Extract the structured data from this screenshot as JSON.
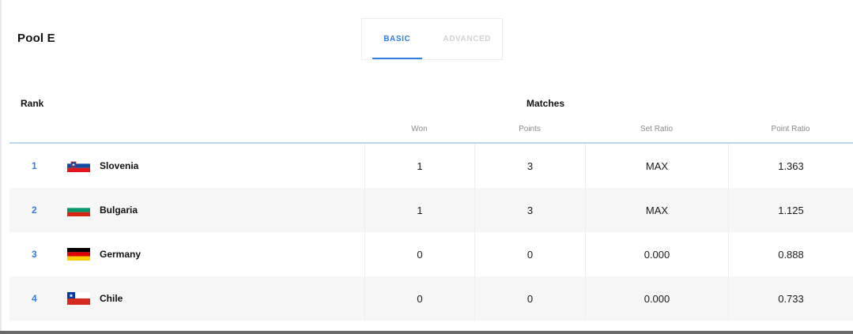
{
  "pool": {
    "title": "Pool E"
  },
  "tabs": [
    {
      "label": "BASIC",
      "active": true
    },
    {
      "label": "ADVANCED",
      "active": false
    }
  ],
  "headers": {
    "rank": "Rank",
    "matches": "Matches",
    "won": "Won",
    "points": "Points",
    "set_ratio": "Set Ratio",
    "point_ratio": "Point Ratio"
  },
  "colors": {
    "accent": "#2f7ee0",
    "inactive_tab": "#cfd3d8",
    "row_alt": "#f6f6f6",
    "header_rule": "#b9d4f3"
  },
  "rows": [
    {
      "rank": "1",
      "team": "Slovenia",
      "flag": "slovenia-flag-icon",
      "won": "1",
      "points": "3",
      "set_ratio": "MAX",
      "point_ratio": "1.363"
    },
    {
      "rank": "2",
      "team": "Bulgaria",
      "flag": "bulgaria-flag-icon",
      "won": "1",
      "points": "3",
      "set_ratio": "MAX",
      "point_ratio": "1.125"
    },
    {
      "rank": "3",
      "team": "Germany",
      "flag": "germany-flag-icon",
      "won": "0",
      "points": "0",
      "set_ratio": "0.000",
      "point_ratio": "0.888"
    },
    {
      "rank": "4",
      "team": "Chile",
      "flag": "chile-flag-icon",
      "won": "0",
      "points": "0",
      "set_ratio": "0.000",
      "point_ratio": "0.733"
    }
  ]
}
